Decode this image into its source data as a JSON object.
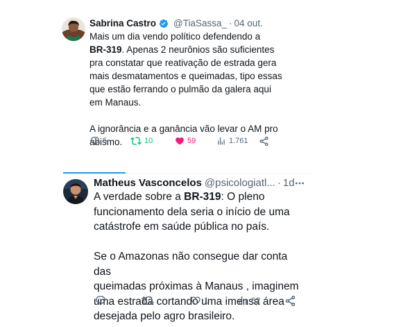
{
  "tweets": [
    {
      "author": {
        "name": "Sabrina Castro",
        "handle": "@TiaSassa_",
        "verified": true
      },
      "separator": "·",
      "time": "04 out.",
      "text_before": "Mais um dia vendo político defendendo a\n",
      "highlight": "BR-319",
      "text_after": ". Apenas 2 neurônios são suficientes\npra constatar que reativação de estrada gera\nmais desmatamentos e queimadas, tipo essas\nque estão ferrando o pulmão da galera aqui\nem Manaus.\n\nA ignorância e a ganância vão levar o AM pro\nabismo.",
      "actions": {
        "replies": "5",
        "reposts": "10",
        "likes": "59",
        "views": "1.761"
      },
      "liked": true,
      "reposted": true
    },
    {
      "author": {
        "name": "Matheus Vasconcelos",
        "handle": "@psicologiatl...",
        "verified": false
      },
      "separator": "·",
      "time": "1d",
      "text_before": "A verdade sobre a ",
      "highlight": "BR-319",
      "text_after": ": O pleno\nfuncionamento dela seria o início de uma\ncatástrofe em saúde pública no país.\n\nSe o Amazonas não consegue dar conta das\nqueimadas próximas à Manaus , imaginem\numa estrada cortando uma imensa área\ndesejada pelo agro brasileiro.",
      "actions": {
        "replies": "",
        "reposts": "",
        "likes": "1",
        "views": "62"
      },
      "liked": false,
      "reposted": false
    }
  ],
  "colors": {
    "text": "#0f1419",
    "secondary": "#536471",
    "accent": "#1d9bf0",
    "like": "#f91880",
    "repost": "#00ba7c"
  },
  "icons": {
    "verified": "verified-badge-icon",
    "reply": "reply-icon",
    "repost": "repost-icon",
    "like": "heart-icon",
    "views": "views-icon",
    "share": "share-icon",
    "more": "more-icon"
  }
}
